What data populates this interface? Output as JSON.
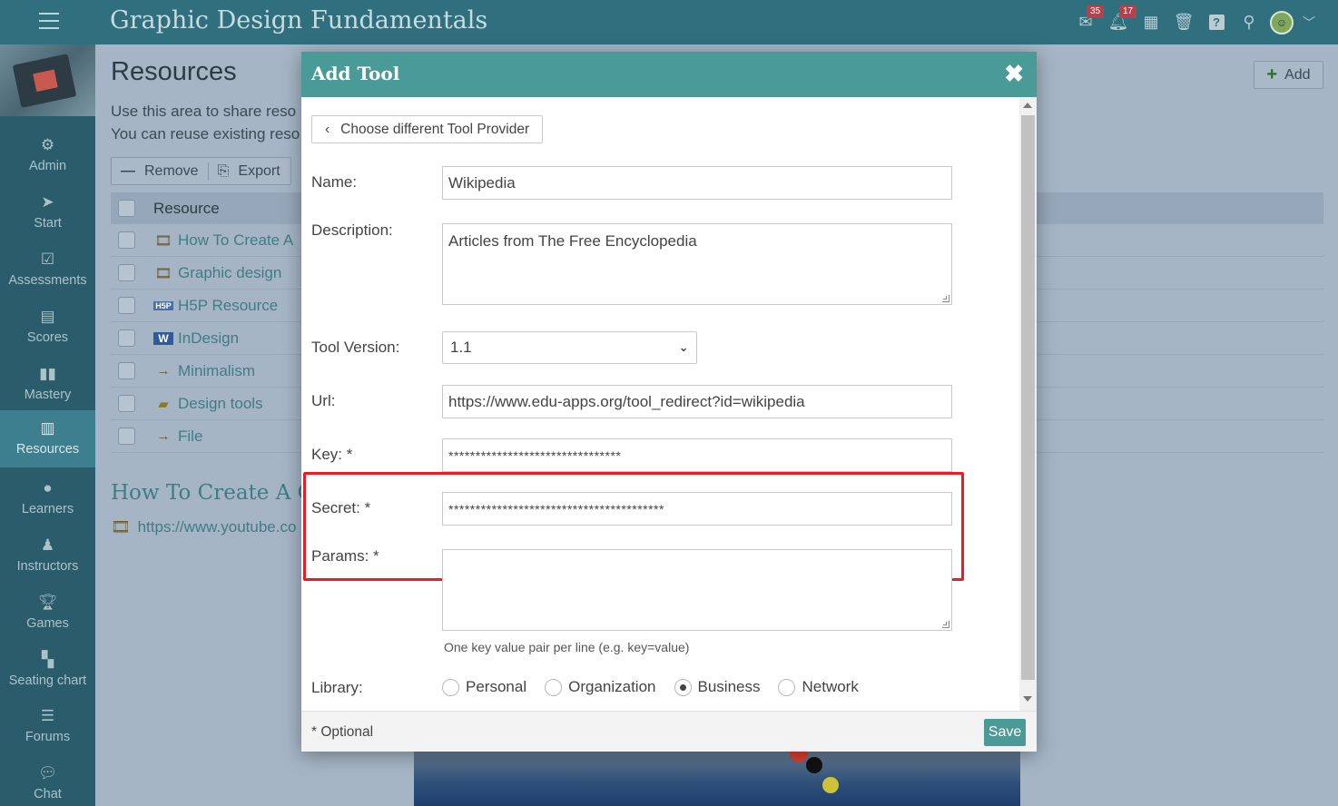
{
  "app": {
    "course_title": "Graphic Design Fundamentals",
    "messages_badge": "35",
    "notifications_badge": "17"
  },
  "sidebar": {
    "items": [
      {
        "label": "Admin",
        "icon": "gear-icon"
      },
      {
        "label": "Start",
        "icon": "arrow-icon"
      },
      {
        "label": "Assessments",
        "icon": "check-icon"
      },
      {
        "label": "Scores",
        "icon": "grid-icon"
      },
      {
        "label": "Mastery",
        "icon": "bar-chart-icon"
      },
      {
        "label": "Resources",
        "icon": "books-icon",
        "active": true
      },
      {
        "label": "Learners",
        "icon": "user-icon"
      },
      {
        "label": "Instructors",
        "icon": "instructor-icon"
      },
      {
        "label": "Games",
        "icon": "trophy-icon"
      },
      {
        "label": "Seating chart",
        "icon": "seating-icon"
      },
      {
        "label": "Forums",
        "icon": "list-icon"
      },
      {
        "label": "Chat",
        "icon": "chat-icon"
      }
    ]
  },
  "page": {
    "title": "Resources",
    "desc_line1": "Use this area to share reso",
    "desc_line2": "You can reuse existing reso",
    "add_label": "Add",
    "remove_label": "Remove",
    "export_label": "Export",
    "column_resource": "Resource",
    "rows": [
      {
        "name": "How To Create A",
        "icon": "film-icon"
      },
      {
        "name": "Graphic design",
        "icon": "film-icon"
      },
      {
        "name": "H5P Resource",
        "icon": "h5p-icon"
      },
      {
        "name": "InDesign",
        "icon": "word-icon"
      },
      {
        "name": "Minimalism",
        "icon": "arrow-right-icon"
      },
      {
        "name": "Design tools",
        "icon": "folder-icon"
      },
      {
        "name": "File",
        "icon": "arrow-right-icon"
      }
    ],
    "section_title": "How To Create A Gr",
    "section_link": "https://www.youtube.co"
  },
  "modal": {
    "title": "Add Tool",
    "provider_button": "Choose different Tool Provider",
    "name_label": "Name:",
    "name_value": "Wikipedia",
    "description_label": "Description:",
    "description_value": "Articles from The Free Encyclopedia",
    "version_label": "Tool Version:",
    "version_value": "1.1",
    "url_label": "Url:",
    "url_value": "https://www.edu-apps.org/tool_redirect?id=wikipedia",
    "key_label": "Key: *",
    "key_value": "********************************",
    "secret_label": "Secret: *",
    "secret_value": "****************************************",
    "params_label": "Params: *",
    "params_value": "",
    "params_hint": "One key value pair per line (e.g. key=value)",
    "library_label": "Library:",
    "library_options": [
      "Personal",
      "Organization",
      "Business",
      "Network"
    ],
    "library_selected": "Business",
    "optional_note": "* Optional",
    "save_label": "Save"
  },
  "colors": {
    "topbar": "#306f7e",
    "sidebar": "#2b5c6b",
    "modal_header": "#4a9a98",
    "highlight": "#ec1c24"
  }
}
